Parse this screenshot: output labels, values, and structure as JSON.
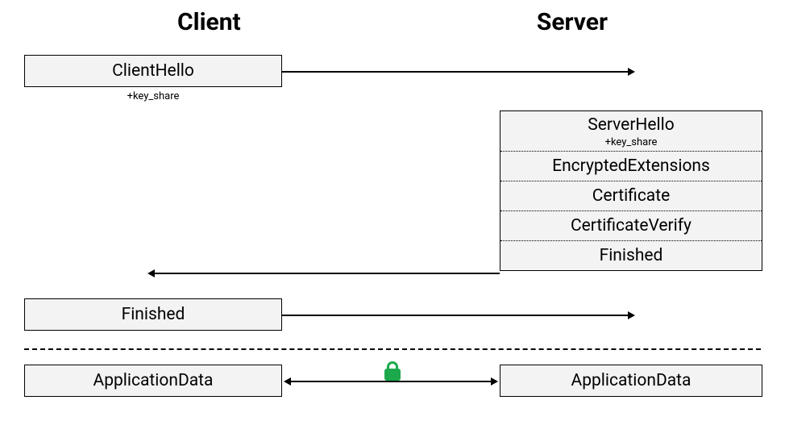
{
  "headings": {
    "client": "Client",
    "server": "Server"
  },
  "client_hello": {
    "title": "ClientHello",
    "sub": "+key_share"
  },
  "server_stack": {
    "server_hello": {
      "title": "ServerHello",
      "sub": "+key_share"
    },
    "encrypted_extensions": "EncryptedExtensions",
    "certificate": "Certificate",
    "certificate_verify": "CertificateVerify",
    "finished": "Finished"
  },
  "client_finished": "Finished",
  "app_data_client": "ApplicationData",
  "app_data_server": "ApplicationData"
}
